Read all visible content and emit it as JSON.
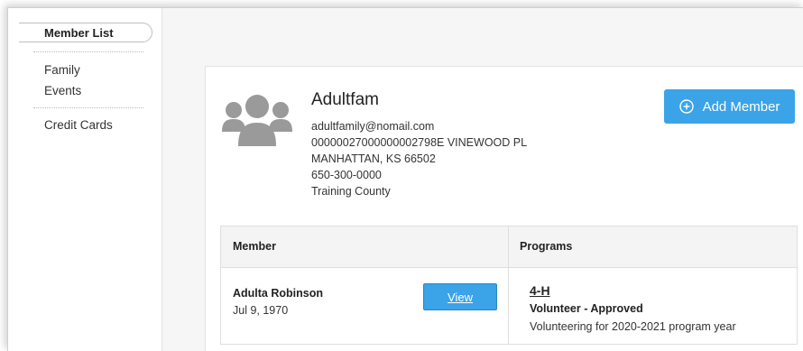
{
  "sidebar": {
    "active_item": "Member List",
    "items": [
      "Family",
      "Events",
      "Credit Cards"
    ]
  },
  "family": {
    "avatar_icon": "people-group-icon",
    "name": "Adultfam",
    "email": "adultfamily@nomail.com",
    "address_line1": "00000027000000002798E VINEWOOD PL",
    "address_line2": "MANHATTAN, KS 66502",
    "phone": "650-300-0000",
    "county": "Training County"
  },
  "add_member": {
    "label": "Add Member",
    "icon": "plus-circle-icon"
  },
  "members_table": {
    "headers": {
      "member": "Member",
      "programs": "Programs"
    },
    "rows": [
      {
        "name": "Adulta Robinson",
        "dob": "Jul 9, 1970",
        "view_label": "View",
        "program": "4-H",
        "status": "Volunteer - Approved",
        "description": "Volunteering for 2020-2021 program year"
      }
    ]
  },
  "colors": {
    "primary_button": "#3ba3e8",
    "avatar_gray": "#9a9a9a"
  }
}
